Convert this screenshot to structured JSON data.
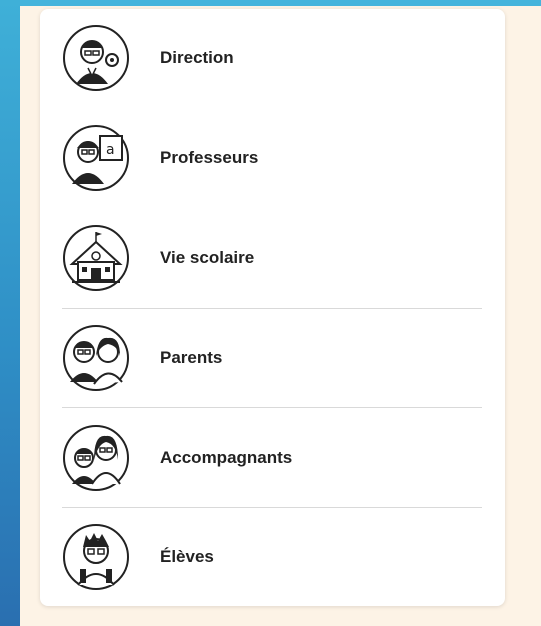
{
  "roles": [
    {
      "label": "Direction",
      "icon": "director-icon"
    },
    {
      "label": "Professeurs",
      "icon": "teacher-icon"
    },
    {
      "label": "Vie scolaire",
      "icon": "school-building-icon"
    },
    {
      "label": "Parents",
      "icon": "parents-icon"
    },
    {
      "label": "Accompagnants",
      "icon": "companions-icon"
    },
    {
      "label": "Élèves",
      "icon": "student-icon"
    }
  ],
  "colors": {
    "background": "#fdf3e6",
    "panel": "#ffffff",
    "accent_blue": "#2f8fc6",
    "text": "#222222",
    "divider": "#d9d9d9"
  }
}
